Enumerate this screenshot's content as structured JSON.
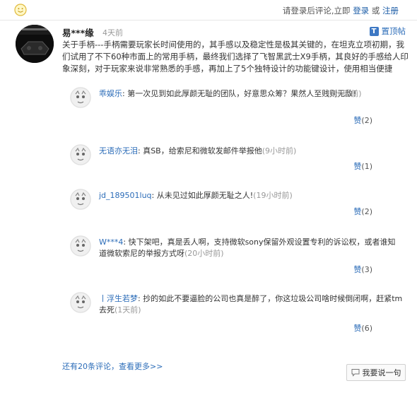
{
  "header": {
    "prompt": "请登录后评论,立即",
    "login": "登录",
    "or": "或",
    "register": "注册"
  },
  "comment": {
    "user": "易***缘",
    "time": "4天前",
    "pin_label": "置顶帖",
    "body": "关于手柄---手柄需要玩家长时间使用的，其手感以及稳定性是极其关键的，在坦克立项初期，我们试用了不下60种市面上的常用手柄，最终我们选择了飞智黑武士X9手柄，其良好的手感给人印象深刻，对于玩家来说非常熟悉的手感，再加上了5个独特设计的功能键设计，使用相当便捷"
  },
  "replies": [
    {
      "user": "乖娱乐",
      "text": "第一次见到如此厚颜无耻的团队，好意思众筹？果然人至贱则无敌！",
      "time": "(6小时前)",
      "like_label": "赞",
      "like_count": "(2)"
    },
    {
      "user": "无语亦无泪",
      "text": "真SB，给索尼和微软发邮件举报他",
      "time": "(9小时前)",
      "like_label": "赞",
      "like_count": "(1)"
    },
    {
      "user": "jd_189501luq",
      "text": "从未见过如此厚颜无耻之人!",
      "time": "(19小时前)",
      "like_label": "赞",
      "like_count": "(2)"
    },
    {
      "user": "W***4",
      "text": "快下架吧，真是丢人啊，支持微软sony保留外观设置专利的诉讼权，或者谁知道微软索尼的举报方式呀",
      "time": "(20小时前)",
      "like_label": "赞",
      "like_count": "(3)"
    },
    {
      "user": "丨浮生若梦",
      "text": "抄的如此不要逼脸的公司也真是醉了，你这垃圾公司啥时候倒闭啊，赶紧tm去死",
      "time": "(1天前)",
      "like_label": "赞",
      "like_count": "(6)"
    }
  ],
  "footer": {
    "count_text": "还有20条评论，",
    "more_link": "查看更多>>",
    "write_button": "我要说一句"
  },
  "colors": {
    "link": "#2b6cb8",
    "text": "#333333",
    "muted": "#999999"
  }
}
